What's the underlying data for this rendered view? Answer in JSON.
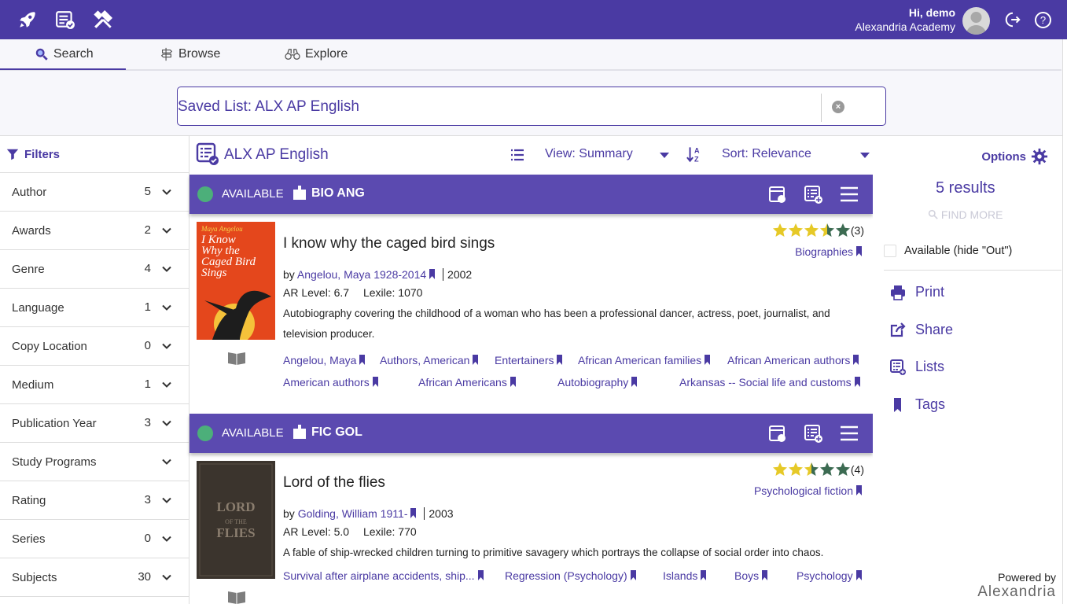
{
  "header": {
    "greeting": "Hi, demo",
    "organization": "Alexandria Academy",
    "icons": [
      "rocket-icon",
      "list-check-icon",
      "tools-icon"
    ],
    "help_label": "?"
  },
  "tabs": [
    {
      "label": "Search",
      "icon": "search-icon",
      "active": true
    },
    {
      "label": "Browse",
      "icon": "signpost-icon",
      "active": false
    },
    {
      "label": "Explore",
      "icon": "binoculars-icon",
      "active": false
    }
  ],
  "search": {
    "value": "Saved List: ALX AP English",
    "clear_label": "×"
  },
  "filters": {
    "title": "Filters",
    "items": [
      {
        "label": "Author",
        "count": "5"
      },
      {
        "label": "Awards",
        "count": "2"
      },
      {
        "label": "Genre",
        "count": "4"
      },
      {
        "label": "Language",
        "count": "1"
      },
      {
        "label": "Copy Location",
        "count": "0"
      },
      {
        "label": "Medium",
        "count": "1"
      },
      {
        "label": "Publication Year",
        "count": "3"
      },
      {
        "label": "Study Programs",
        "count": ""
      },
      {
        "label": "Rating",
        "count": "3"
      },
      {
        "label": "Series",
        "count": "0"
      },
      {
        "label": "Subjects",
        "count": "30"
      }
    ]
  },
  "list": {
    "title": "ALX AP English",
    "view_label": "View: Summary",
    "sort_label": "Sort: Relevance"
  },
  "records": [
    {
      "status": "AVAILABLE",
      "call_number": "BIO ANG",
      "title": "I know why the caged bird sings",
      "by_prefix": "by",
      "author": "Angelou, Maya 1928-2014",
      "year": "2002",
      "ar_level": "AR Level: 6.7",
      "lexile": "Lexile: 1070",
      "summary": "Autobiography covering the childhood of a woman who has been a professional dancer, actress, poet, journalist, and television producer.",
      "rating_count": "(3)",
      "rating": 3.5,
      "genre": "Biographies",
      "cover_author": "Maya Angelou",
      "cover_title": "I Know Why the Caged Bird Sings",
      "subjects": [
        "Angelou, Maya",
        "Authors, American",
        "Entertainers",
        "African American families",
        "African American authors",
        "American authors",
        "African Americans",
        "Autobiography",
        "Arkansas -- Social life and customs"
      ]
    },
    {
      "status": "AVAILABLE",
      "call_number": "FIC GOL",
      "title": "Lord of the flies",
      "by_prefix": "by",
      "author": "Golding, William 1911-",
      "year": "2003",
      "ar_level": "AR Level: 5.0",
      "lexile": "Lexile: 770",
      "summary": "A fable of ship-wrecked children turning to primitive savagery which portrays the collapse of social order into chaos.",
      "rating_count": "(4)",
      "rating": 2.5,
      "genre": "Psychological fiction",
      "cover_title": "LORD OF THE FLIES",
      "subjects": [
        "Survival after airplane accidents, ship...",
        "Regression (Psychology)",
        "Islands",
        "Boys",
        "Psychology"
      ]
    }
  ],
  "right_panel": {
    "options_label": "Options",
    "results_label": "5 results",
    "find_more_label": "FIND MORE",
    "available_label": "Available (hide \"Out\")",
    "actions": [
      {
        "label": "Print",
        "icon": "print-icon"
      },
      {
        "label": "Share",
        "icon": "share-icon"
      },
      {
        "label": "Lists",
        "icon": "list-icon"
      },
      {
        "label": "Tags",
        "icon": "bookmark-icon"
      }
    ],
    "powered_by": "Powered by",
    "brand": "Alexandria"
  },
  "colors": {
    "primary": "#4a3aa3",
    "record_bar": "#5b4ab0",
    "available_dot": "#4caf7a",
    "star_filled": "#e6c927",
    "star_empty": "#3c6b52"
  }
}
